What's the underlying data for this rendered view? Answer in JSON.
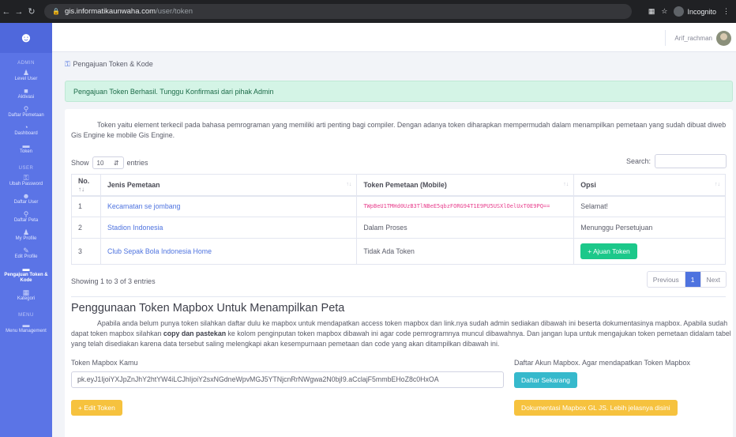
{
  "browser": {
    "url_host": "gis.informatikaunwaha.com",
    "url_path": "/user/token",
    "incognito_label": "Incognito"
  },
  "sidebar": {
    "sections": {
      "admin": "ADMIN",
      "user": "USER",
      "menu": "MENU"
    },
    "admin_items": [
      {
        "label": "Level User",
        "icon": "user-icon"
      },
      {
        "label": "Aktivasi",
        "icon": "lock-icon"
      },
      {
        "label": "Daftar Pemetaan",
        "icon": "map-marker-icon"
      },
      {
        "label": "Dashboard",
        "icon": "dashboard-icon"
      },
      {
        "label": "Token",
        "icon": "key-icon"
      }
    ],
    "user_items": [
      {
        "label": "Ubah Password",
        "icon": "key-icon"
      },
      {
        "label": "Daftar User",
        "icon": "users-icon"
      },
      {
        "label": "Daftar Peta",
        "icon": "map-marker-icon"
      },
      {
        "label": "My Profile",
        "icon": "user-icon"
      },
      {
        "label": "Edit Profile",
        "icon": "user-edit-icon"
      },
      {
        "label": "Pengajuan Token & Kode",
        "icon": "key-icon"
      },
      {
        "label": "Kategori",
        "icon": "grid-icon"
      }
    ],
    "menu_items": [
      {
        "label": "Menu Management",
        "icon": "folder-icon"
      }
    ]
  },
  "topbar": {
    "username": "Arif_rachman"
  },
  "breadcrumb": {
    "text": "Pengajuan Token & Kode"
  },
  "alert": {
    "text": "Pengajuan Token Berhasil. Tunggu Konfirmasi dari pihak Admin"
  },
  "intro": {
    "text": "Token yaitu element terkecil pada bahasa pemrograman yang memiliki arti penting bagi compiler. Dengan adanya token diharapkan mempermudah dalam menampilkan pemetaan yang sudah dibuat diweb Gis Engine ke mobile Gis Engine."
  },
  "table_controls": {
    "show": "Show",
    "entries_value": "10",
    "entries": "entries",
    "search_label": "Search:"
  },
  "table": {
    "headers": [
      "No.",
      "Jenis Pemetaan",
      "Token Pemetaan (Mobile)",
      "Opsi"
    ],
    "rows": [
      {
        "no": "1",
        "jenis": "Kecamatan se jombang",
        "token": "TWpBeU1TMHd0UzB3TlNBeE5qbzFORG94T1E9PU5USXlOelUxT0E9PQ==",
        "opsi": "Selamat!"
      },
      {
        "no": "2",
        "jenis": "Stadion Indonesia",
        "token": "Dalam Proses",
        "opsi": "Menunggu Persetujuan"
      },
      {
        "no": "3",
        "jenis": "Club Sepak Bola Indonesia Home",
        "token": "Tidak Ada Token",
        "opsi": "+ Ajuan Token"
      }
    ],
    "info": "Showing 1 to 3 of 3 entries",
    "pager": {
      "previous": "Previous",
      "page": "1",
      "next": "Next"
    }
  },
  "mapbox": {
    "title": "Penggunaan Token Mapbox Untuk Menampilkan Peta",
    "text_part1": "Apabila anda belum punya token silahkan daftar dulu ke mapbox untuk mendapatkan access token mapbox dan link.nya sudah admin sediakan dibawah ini beserta dokumentasinya mapbox. Apabila sudah dapat token mapbox silahkan ",
    "text_bold": "copy dan pastekan",
    "text_part2": " ke kolom penginputan token mapbox dibawah ini agar code pemrogramnya muncul dibawahnya. Dan jangan lupa untuk mengajukan token pemetaan didalam tabel yang telah disediakan karena data tersebut saling melengkapi akan kesempurnaan pemetaan dan code yang akan ditampilkan dibawah ini.",
    "token_label": "Token Mapbox Kamu",
    "token_value": "pk.eyJ1IjoiYXJpZnJhY2htYW4iLCJhIjoiY2sxNGdneWpvMGJ5YTNjcnRrNWgwa2N0bjI9.aCclajF5mmbEHoZ8c0HxOA",
    "account_label": "Daftar Akun Mapbox. Agar mendapatkan Token Mapbox",
    "daftar_button": "Daftar Sekarang",
    "edit_button": "+ Edit Token",
    "doc_button": "Dokumentasi Mapbox GL JS. Lebih jelasnya disini"
  },
  "colors": {
    "sidebar": "#5b74e6",
    "success": "#1cc88a",
    "info": "#36b9cc",
    "warning": "#f6c23e",
    "primary": "#4e73df",
    "token_code": "#e83e8c"
  }
}
